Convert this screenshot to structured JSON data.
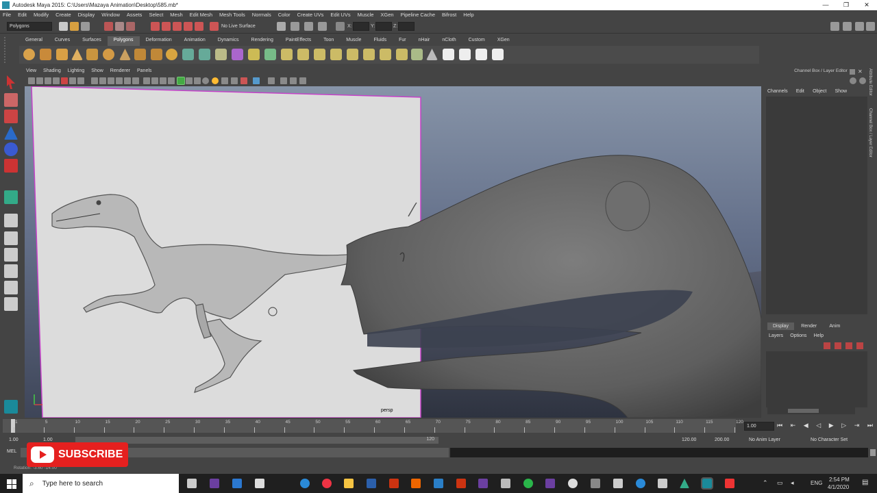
{
  "window": {
    "title": "Autodesk Maya 2015: C:\\Users\\Mazaya Animation\\Desktop\\585.mb*",
    "controls": [
      "—",
      "❐",
      "✕"
    ]
  },
  "menu": [
    "File",
    "Edit",
    "Modify",
    "Create",
    "Display",
    "Window",
    "Assets",
    "Select",
    "Mesh",
    "Edit Mesh",
    "Mesh Tools",
    "Normals",
    "Color",
    "Create UVs",
    "Edit UVs",
    "Muscle",
    "XGen",
    "Pipeline Cache",
    "Bifrost",
    "Help"
  ],
  "status_line": {
    "mode": "Polygons",
    "live_surface": "No Live Surface",
    "x_label": "X:",
    "y_label": "Y:",
    "z_label": "Z:"
  },
  "shelf": {
    "tabs": [
      "General",
      "Curves",
      "Surfaces",
      "Polygons",
      "Deformation",
      "Animation",
      "Dynamics",
      "Rendering",
      "PaintEffects",
      "Toon",
      "Muscle",
      "Fluids",
      "Fur",
      "nHair",
      "nCloth",
      "Custom",
      "XGen"
    ],
    "active_tab": "Polygons"
  },
  "viewport": {
    "menu": [
      "View",
      "Shading",
      "Lighting",
      "Show",
      "Renderer",
      "Panels"
    ],
    "camera_label": "persp"
  },
  "channel_box": {
    "header": "Channel Box / Layer Editor",
    "tabs": [
      "Channels",
      "Edit",
      "Object",
      "Show"
    ]
  },
  "layer_editor": {
    "tabs": [
      "Display",
      "Render",
      "Anim"
    ],
    "active_tab": "Display",
    "menu": [
      "Layers",
      "Options",
      "Help"
    ]
  },
  "side_tabs": [
    "Attribute Editor",
    "Channel Box / Layer Editor"
  ],
  "timeline": {
    "ticks": [
      "1",
      "5",
      "10",
      "15",
      "20",
      "25",
      "30",
      "35",
      "40",
      "45",
      "50",
      "55",
      "60",
      "65",
      "70",
      "75",
      "80",
      "85",
      "90",
      "95",
      "100",
      "105",
      "110",
      "115",
      "120"
    ],
    "current_frame": "1.00"
  },
  "range": {
    "start": "1.00",
    "inner_start": "1.00",
    "inner_end": "120",
    "end": "120.00",
    "max": "200.00",
    "anim_layer": "No Anim Layer",
    "character_set": "No Character Set"
  },
  "command_line": {
    "label": "MEL"
  },
  "help_line": {
    "text": "Rotation: -3.60 -14.00"
  },
  "overlay": {
    "subscribe_label": "SUBSCRIBE"
  },
  "taskbar": {
    "search_placeholder": "Type here to search",
    "time": "2:54 PM",
    "date": "4/1/2020",
    "language": "ENG"
  },
  "colors": {
    "ui_bg": "#444444",
    "viewport_top": "#8794a8",
    "viewport_bottom": "#3e4558",
    "image_plane": "#d8d8d8",
    "selection_magenta": "#c542c8",
    "subscribe_red": "#e5201f"
  }
}
